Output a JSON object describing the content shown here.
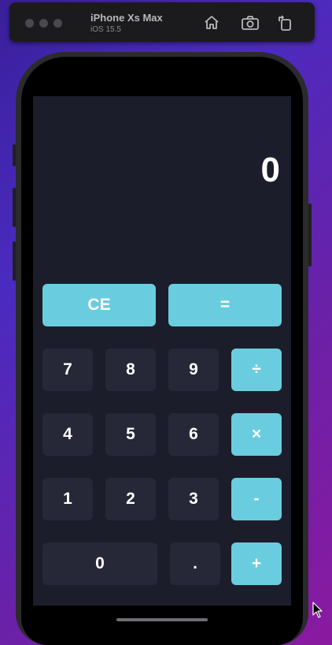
{
  "simulator": {
    "device_name": "iPhone Xs Max",
    "os_version": "iOS 15.5",
    "toolbar_icons": [
      "home-icon",
      "screenshot-icon",
      "rotate-icon"
    ]
  },
  "calculator": {
    "display": "0",
    "keys": {
      "ce": "CE",
      "equals": "=",
      "seven": "7",
      "eight": "8",
      "nine": "9",
      "divide": "÷",
      "four": "4",
      "five": "5",
      "six": "6",
      "multiply": "×",
      "one": "1",
      "two": "2",
      "three": "3",
      "minus": "-",
      "zero": "0",
      "dot": ".",
      "plus": "+"
    }
  },
  "colors": {
    "screen_bg": "#1c1d2a",
    "number_key_bg": "#262838",
    "operator_key_bg": "#6acddf",
    "text": "#ffffff"
  }
}
